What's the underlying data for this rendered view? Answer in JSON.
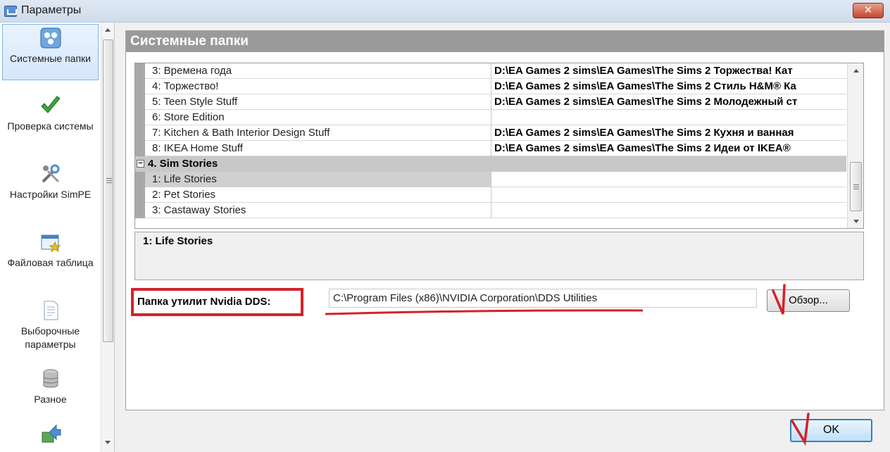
{
  "window": {
    "title": "Параметры",
    "close_label": "✕"
  },
  "sidebar": {
    "items": [
      {
        "label": "Системные папки",
        "icon": "system-folders-icon",
        "selected": true
      },
      {
        "label": "Проверка системы",
        "icon": "checkmark-icon",
        "selected": false
      },
      {
        "label": "Настройки SimPE",
        "icon": "tools-icon",
        "selected": false
      },
      {
        "label": "Файловая таблица",
        "icon": "file-table-icon",
        "selected": false
      },
      {
        "label": "Выборочные параметры",
        "icon": "document-icon",
        "selected": false
      },
      {
        "label": "Разное",
        "icon": "database-icon",
        "selected": false
      },
      {
        "label": "",
        "icon": "upload-icon",
        "selected": false
      }
    ]
  },
  "panel": {
    "header": "Системные папки"
  },
  "grid": {
    "rows": [
      {
        "name": "3: Времена года",
        "value": "D:\\EA Games 2 sims\\EA Games\\The Sims 2 Торжества! Кат"
      },
      {
        "name": "4: Торжество!",
        "value": "D:\\EA Games 2 sims\\EA Games\\The Sims 2 Стиль H&M® Ка"
      },
      {
        "name": "5: Teen Style Stuff",
        "value": "D:\\EA Games 2 sims\\EA Games\\The Sims 2 Молодежный ст"
      },
      {
        "name": "6: Store Edition",
        "value": ""
      },
      {
        "name": "7: Kitchen & Bath Interior Design Stuff",
        "value": "D:\\EA Games 2 sims\\EA Games\\The Sims 2 Кухня и ванная"
      },
      {
        "name": "8: IKEA Home Stuff",
        "value": "D:\\EA Games 2 sims\\EA Games\\The Sims 2 Идеи от IKEA®"
      }
    ],
    "category": {
      "toggle": "⊟",
      "label": "4. Sim Stories"
    },
    "sub_rows": [
      {
        "name": "1: Life Stories",
        "value": "",
        "selected": true
      },
      {
        "name": "2: Pet Stories",
        "value": "",
        "selected": false
      },
      {
        "name": "3: Castaway Stories",
        "value": "",
        "selected": false
      }
    ]
  },
  "description": {
    "title": "1: Life Stories"
  },
  "dds": {
    "label": "Папка утилит Nvidia DDS:",
    "path": "C:\\Program Files (x86)\\NVIDIA Corporation\\DDS Utilities",
    "browse_label": "Обзор..."
  },
  "footer": {
    "ok_label": "OK"
  },
  "colors": {
    "annotation_red": "#d4222a",
    "header_gray": "#9a9a9a",
    "selection_blue": "#7eb4ea"
  }
}
